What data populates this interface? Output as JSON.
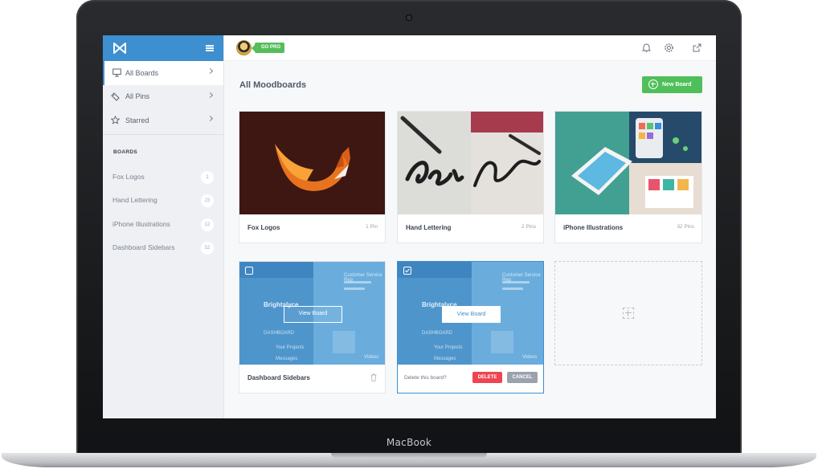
{
  "device": {
    "brand": "MacBook"
  },
  "sidebar": {
    "nav": [
      {
        "label": "All Boards",
        "active": true,
        "icon": "monitor-icon"
      },
      {
        "label": "All Pins",
        "active": false,
        "icon": "pin-tag-icon"
      },
      {
        "label": "Starred",
        "active": false,
        "icon": "star-icon"
      }
    ],
    "boards_heading": "BOARDS",
    "boards": [
      {
        "label": "Fox Logos",
        "count": "1"
      },
      {
        "label": "Hand Lettering",
        "count": "23"
      },
      {
        "label": "iPhone Illustrations",
        "count": "12"
      },
      {
        "label": "Dashboard Sidebars",
        "count": "52"
      }
    ]
  },
  "topbar": {
    "badge": "GO PRO",
    "icons": [
      "bell-icon",
      "gear-icon",
      "external-link-icon"
    ]
  },
  "main": {
    "title": "All Moodboards",
    "new_board_label": "New Board",
    "cards": [
      {
        "title": "Fox Logos",
        "pins": "1 Pin"
      },
      {
        "title": "Hand Lettering",
        "pins": "2 Pins"
      },
      {
        "title": "iPhone Illustrations",
        "pins": "32 Pins"
      },
      {
        "title": "Dashboard Sidebars",
        "view_label": "View Board"
      },
      {
        "view_label": "View Board",
        "delete_prompt": "Delete this board?",
        "delete_label": "DELETE",
        "cancel_label": "CANCEL"
      }
    ],
    "thumb_text": {
      "brand": "Brightalyce",
      "dashboard": "DASHBOARD",
      "projects": "Your Projects",
      "messages": "Messages",
      "customer": "Customer Service Rep",
      "videos": "Videos"
    }
  },
  "colors": {
    "accent_blue": "#3d8fd0",
    "green": "#4fbf5a",
    "delete_red": "#ef4451"
  }
}
